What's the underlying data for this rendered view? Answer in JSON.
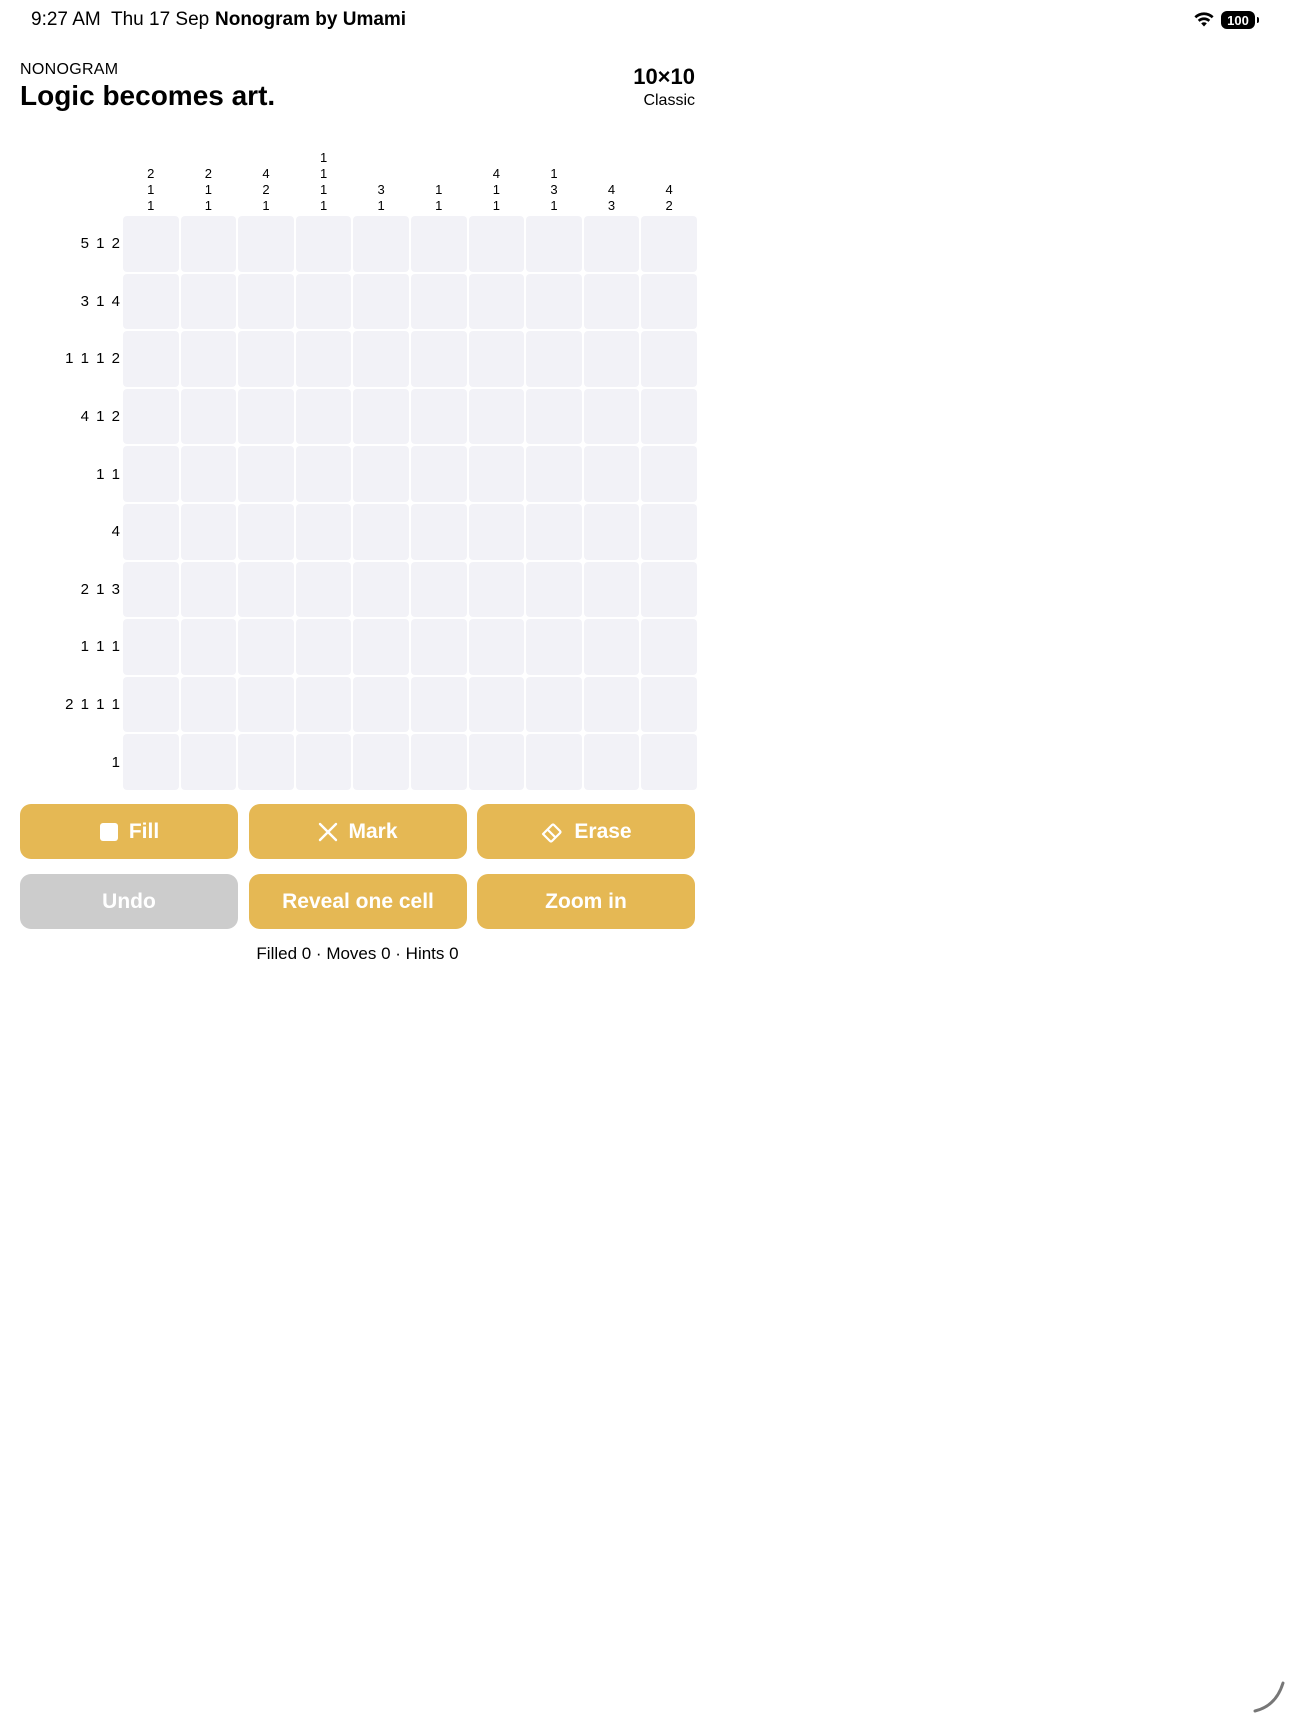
{
  "status_bar": {
    "time": "9:27 AM",
    "date": "Thu 17 Sep",
    "app_name": "Nonogram by Umami",
    "battery": "100"
  },
  "header": {
    "eyebrow": "NONOGRAM",
    "title": "Logic becomes art.",
    "size": "10×10",
    "mode": "Classic"
  },
  "column_clues": [
    [
      "2",
      "1",
      "1"
    ],
    [
      "2",
      "1",
      "1"
    ],
    [
      "4",
      "2",
      "1"
    ],
    [
      "1",
      "1",
      "1",
      "1"
    ],
    [
      "3",
      "1"
    ],
    [
      "1",
      "1"
    ],
    [
      "4",
      "1",
      "1"
    ],
    [
      "1",
      "3",
      "1"
    ],
    [
      "4",
      "3"
    ],
    [
      "4",
      "2"
    ]
  ],
  "row_clues": [
    "5 1 2",
    "3 1 4",
    "1 1 1 2",
    "4 1 2",
    "1 1",
    "4",
    "2 1 3",
    "1 1 1",
    "2 1 1 1",
    "1"
  ],
  "toolbar": {
    "fill_label": "Fill",
    "mark_label": "Mark",
    "erase_label": "Erase",
    "undo_label": "Undo",
    "reveal_label": "Reveal one cell",
    "zoom_label": "Zoom in"
  },
  "stats": "Filled 0 · Moves 0 · Hints 0",
  "colors": {
    "accent": "#e5b854",
    "disabled": "#cccccc",
    "cell": "#f2f2f7"
  },
  "icons": {
    "fill": "filled-square-icon",
    "mark": "x-mark-icon",
    "erase": "eraser-icon"
  }
}
